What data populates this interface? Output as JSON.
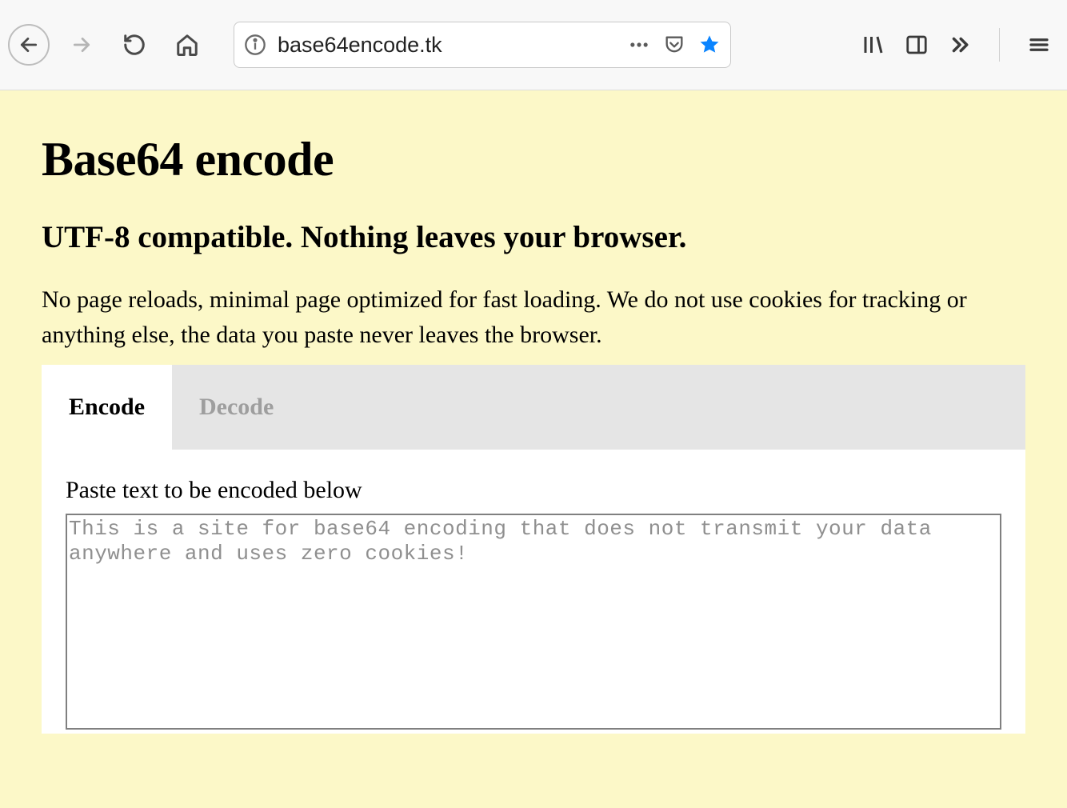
{
  "browser": {
    "url": "base64encode.tk"
  },
  "page": {
    "title": "Base64 encode",
    "subtitle": "UTF-8 compatible. Nothing leaves your browser.",
    "description": "No page reloads, minimal page optimized for fast loading. We do not use cookies for tracking or anything else, the data you paste never leaves the browser.",
    "tabs": {
      "encode": "Encode",
      "decode": "Decode"
    },
    "panel": {
      "label": "Paste text to be encoded below",
      "input_value": "This is a site for base64 encoding that does not transmit your data anywhere and uses zero cookies!"
    }
  }
}
